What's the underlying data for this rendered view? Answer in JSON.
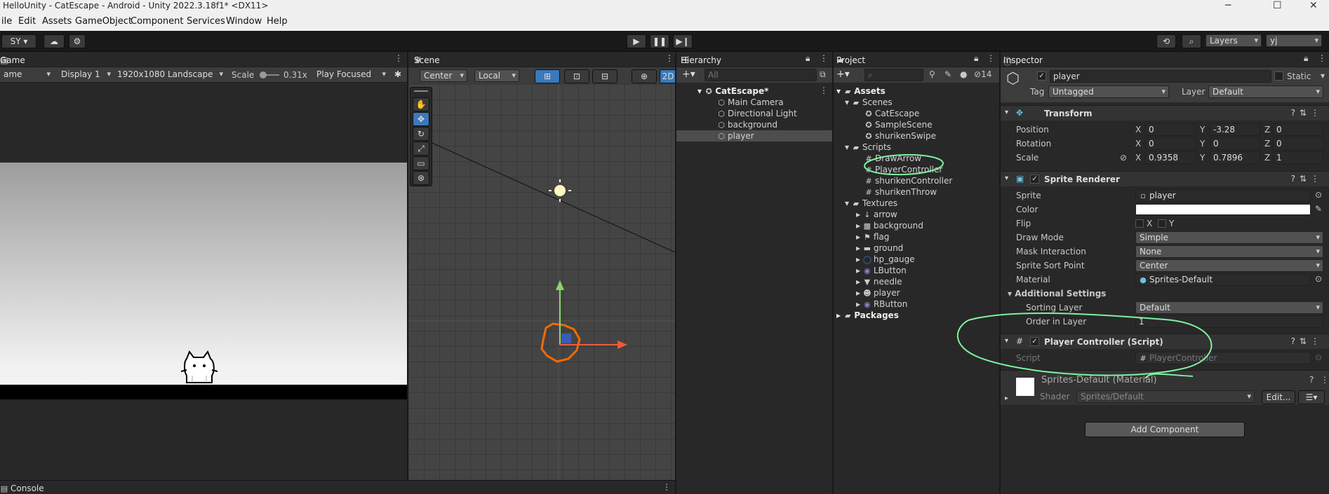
{
  "window": {
    "title": "HelloUnity - CatEscape - Android - Unity 2022.3.18f1* <DX11>",
    "min": "─",
    "max": "☐",
    "close": "✕"
  },
  "menu": [
    "ile",
    "Edit",
    "Assets",
    "GameObject",
    "Component",
    "Services",
    "Window",
    "Help"
  ],
  "toolbar": {
    "account": "SY ▾",
    "layers": "Layers",
    "layout": "yj"
  },
  "game": {
    "tab": "Game",
    "mode": "ame",
    "display": "Display 1",
    "resolution": "1920x1080 Landscape",
    "scale_label": "Scale",
    "scale_value": "0.31x",
    "play_mode": "Play Focused"
  },
  "scene": {
    "tab": "Scene",
    "pivot": "Center",
    "space": "Local",
    "mode2d": "2D"
  },
  "hierarchy": {
    "tab": "Hierarchy",
    "search_placeholder": "All",
    "root": "CatEscape*",
    "items": [
      "Main Camera",
      "Directional Light",
      "background",
      "player"
    ]
  },
  "project": {
    "tab": "Project",
    "count": "14",
    "assets": "Assets",
    "scenes_folder": "Scenes",
    "scenes": [
      "CatEscape",
      "SampleScene",
      "shurikenSwipe"
    ],
    "scripts_folder": "Scripts",
    "scripts": [
      "DrawArrow",
      "PlayerController",
      "shurikenController",
      "shurikenThrow"
    ],
    "textures_folder": "Textures",
    "textures": [
      "arrow",
      "background",
      "flag",
      "ground",
      "hp_gauge",
      "LButton",
      "needle",
      "player",
      "RButton"
    ],
    "packages": "Packages"
  },
  "inspector": {
    "tab": "Inspector",
    "object_name": "player",
    "static_label": "Static",
    "tag_label": "Tag",
    "tag_value": "Untagged",
    "layer_label": "Layer",
    "layer_value": "Default",
    "transform": {
      "title": "Transform",
      "position_label": "Position",
      "position": {
        "x": "0",
        "y": "-3.28",
        "z": "0"
      },
      "rotation_label": "Rotation",
      "rotation": {
        "x": "0",
        "y": "0",
        "z": "0"
      },
      "scale_label": "Scale",
      "scale": {
        "x": "0.9358",
        "y": "0.7896",
        "z": "1"
      }
    },
    "sprite_renderer": {
      "title": "Sprite Renderer",
      "sprite_label": "Sprite",
      "sprite": "player",
      "color_label": "Color",
      "flip_label": "Flip",
      "flip_x": "X",
      "flip_y": "Y",
      "draw_mode_label": "Draw Mode",
      "draw_mode": "Simple",
      "mask_label": "Mask Interaction",
      "mask": "None",
      "sort_point_label": "Sprite Sort Point",
      "sort_point": "Center",
      "material_label": "Material",
      "material": "Sprites-Default",
      "additional": "Additional Settings",
      "sorting_layer_label": "Sorting Layer",
      "sorting_layer": "Default",
      "order_label": "Order in Layer",
      "order": "1"
    },
    "player_controller": {
      "title": "Player Controller (Script)",
      "script_label": "Script",
      "script": "PlayerController"
    },
    "material": {
      "title": "Sprites-Default (Material)",
      "shader_label": "Shader",
      "shader": "Sprites/Default",
      "edit": "Edit..."
    },
    "add_component": "Add Component"
  },
  "console": {
    "tab": "Console"
  },
  "colors": {
    "accent": "#3a79bb",
    "annotation": "#7ef2a0",
    "panel": "#282828",
    "header": "#3c3c3c"
  }
}
